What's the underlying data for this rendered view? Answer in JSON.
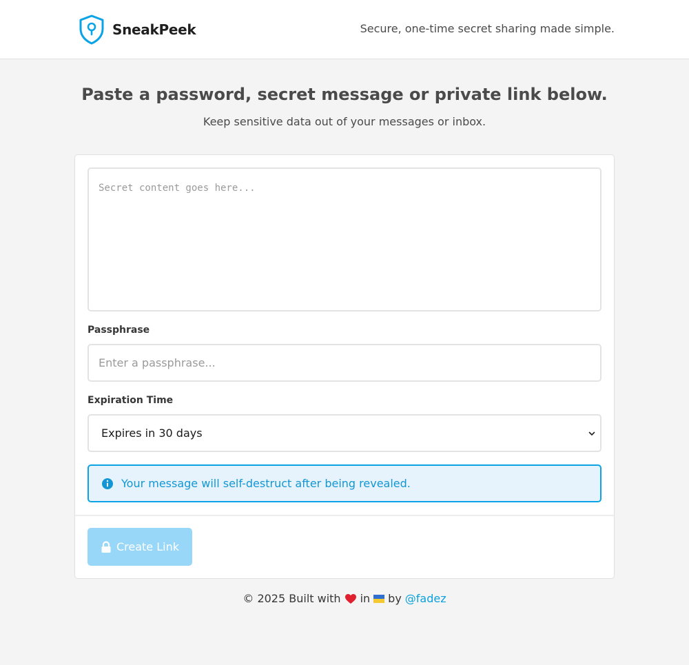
{
  "header": {
    "brand_name": "SneakPeek",
    "tagline": "Secure, one-time secret sharing made simple.",
    "logo_icon": "shield-keyhole-icon"
  },
  "hero": {
    "title": "Paste a password, secret message or private link below.",
    "subtitle": "Keep sensitive data out of your messages or inbox."
  },
  "form": {
    "secret_placeholder": "Secret content goes here...",
    "passphrase_label": "Passphrase",
    "passphrase_placeholder": "Enter a passphrase...",
    "expiration_label": "Expiration Time",
    "expiration_selected": "Expires in 30 days",
    "notice_text": "Your message will self-destruct after being revealed.",
    "notice_icon": "info-circle-icon",
    "create_button_label": "Create Link",
    "create_button_icon": "lock-icon"
  },
  "footer": {
    "prefix": "© 2025 Built with",
    "heart_icon": "heart-icon",
    "in_text": "in",
    "flag_icon": "ukraine-flag-icon",
    "by_text": "by",
    "author": "@fadez"
  },
  "colors": {
    "accent": "#0aa4e6",
    "notice_bg": "#e6f3fc",
    "button_bg": "#98d7f7",
    "heart": "#e0202e"
  }
}
